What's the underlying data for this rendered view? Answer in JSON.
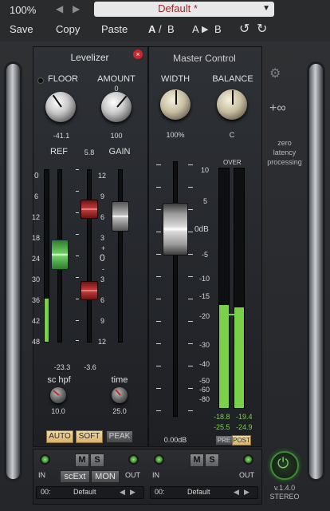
{
  "topbar": {
    "zoom": "100%",
    "preset": "Default *",
    "save": "Save",
    "copy": "Copy",
    "paste": "Paste",
    "a": "A",
    "slash": "/",
    "b": "B",
    "a_to_b_a": "A",
    "a_to_b_b": "B"
  },
  "levelizer": {
    "title": "Levelizer",
    "floor_label": "FLOOR",
    "floor_value": "-41.1",
    "amount_label": "AMOUNT",
    "amount_min": "0",
    "amount_value": "100",
    "ref_label": "REF",
    "ref_value_top": "5.8",
    "gain_label": "GAIN",
    "ref_scale": [
      "0",
      "6",
      "12",
      "18",
      "24",
      "30",
      "36",
      "42",
      "48"
    ],
    "gain_scale": [
      "12",
      "9",
      "6",
      "3",
      "+",
      "0",
      "-",
      "3",
      "6",
      "9",
      "12"
    ],
    "ref_reading": "-23.3",
    "gain_reading": "-3.6",
    "schpf_label": "sc hpf",
    "schpf_value": "10.0",
    "time_label": "time",
    "time_value": "25.0",
    "auto": "AUTO",
    "soft": "SOFT",
    "peak": "PEAK"
  },
  "master": {
    "title": "Master Control",
    "width_label": "WIDTH",
    "width_value": "100%",
    "balance_label": "BALANCE",
    "balance_value": "C",
    "fader_reading": "0.00dB",
    "scale": [
      "10",
      "5",
      "0dB",
      "-5",
      "-10",
      "-15",
      "-20",
      "-30",
      "-40",
      "-50",
      "-60",
      "-80"
    ],
    "over": "OVER",
    "peak_l": "-18.8",
    "peak_r": "-19.4",
    "rms_l": "-25.5",
    "rms_r": "-24.9",
    "pre": "PRE",
    "post": "POST"
  },
  "side": {
    "infinity": "+∞",
    "zero": "zero",
    "latency": "latency",
    "processing": "processing",
    "version": "v.1.4.0",
    "stereo": "STEREO"
  },
  "footer": {
    "in1": "IN",
    "out1": "OUT",
    "in2": "IN",
    "out2": "OUT",
    "m1": "M",
    "s1": "S",
    "m2": "M",
    "s2": "S",
    "scext": "scExt",
    "mon": "MON",
    "slot1_num": "00:",
    "slot1_name": "Default",
    "slot2_num": "00:",
    "slot2_name": "Default"
  },
  "meters": {
    "levelizer_ref_fill": 0.25,
    "master_left_fill": 0.43,
    "master_right_fill": 0.42
  }
}
